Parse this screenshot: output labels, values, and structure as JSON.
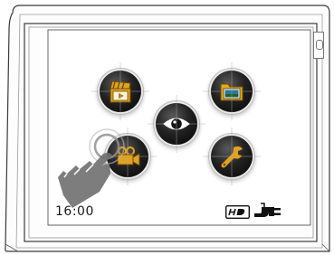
{
  "status_bar": {
    "clock": "16:00",
    "hd_badge_icon": "hd-icon",
    "power_icon": "power-plug-icon"
  },
  "menu": {
    "items": [
      {
        "name": "video-gallery",
        "icon": "clapperboard-icon"
      },
      {
        "name": "file-browser",
        "icon": "folder-icon"
      },
      {
        "name": "view",
        "icon": "eye-icon"
      },
      {
        "name": "record",
        "icon": "camcorder-icon"
      },
      {
        "name": "settings",
        "icon": "wrench-icon"
      }
    ]
  },
  "gesture_overlay": {
    "icon": "pointing-hand-icon"
  },
  "colors": {
    "button": "#111111",
    "icon_gold": "#e0a320",
    "icon_white": "#ffffff"
  }
}
